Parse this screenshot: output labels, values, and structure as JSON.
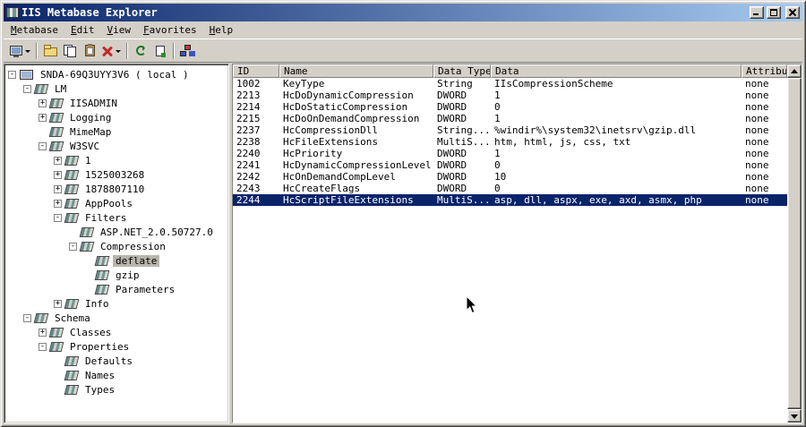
{
  "window": {
    "title": "IIS Metabase Explorer"
  },
  "colors": {
    "chrome": "#d4d0c8",
    "titlebar_start": "#0a246a",
    "titlebar_end": "#a6caf0",
    "selection": "#0a246a",
    "inactive_selection": "#b8b5ac"
  },
  "menu": {
    "items": [
      {
        "key": "M",
        "rest": "etabase"
      },
      {
        "key": "E",
        "rest": "dit"
      },
      {
        "key": "V",
        "rest": "iew"
      },
      {
        "key": "F",
        "rest": "avorites"
      },
      {
        "key": "H",
        "rest": "elp"
      }
    ]
  },
  "toolbar": {
    "buttons": [
      "connect",
      "new-key",
      "copy",
      "paste",
      "delete",
      "refresh",
      "export",
      "network"
    ]
  },
  "tree": {
    "items": [
      {
        "label": "SNDA-69Q3UYY3V6 ( local )",
        "expander": "-"
      },
      {
        "label": "LM",
        "expander": "-"
      },
      {
        "label": "IISADMIN",
        "expander": "+"
      },
      {
        "label": "Logging",
        "expander": "+"
      },
      {
        "label": "MimeMap",
        "expander": ""
      },
      {
        "label": "W3SVC",
        "expander": "-"
      },
      {
        "label": "1",
        "expander": "+"
      },
      {
        "label": "1525003268",
        "expander": "+"
      },
      {
        "label": "1878807110",
        "expander": "+"
      },
      {
        "label": "AppPools",
        "expander": "+"
      },
      {
        "label": "Filters",
        "expander": "-"
      },
      {
        "label": "ASP.NET_2.0.50727.0",
        "expander": ""
      },
      {
        "label": "Compression",
        "expander": "-"
      },
      {
        "label": "deflate",
        "expander": ""
      },
      {
        "label": "gzip",
        "expander": ""
      },
      {
        "label": "Parameters",
        "expander": ""
      },
      {
        "label": "Info",
        "expander": "+"
      },
      {
        "label": "Schema",
        "expander": "-"
      },
      {
        "label": "Classes",
        "expander": "+"
      },
      {
        "label": "Properties",
        "expander": "-"
      },
      {
        "label": "Defaults",
        "expander": ""
      },
      {
        "label": "Names",
        "expander": ""
      },
      {
        "label": "Types",
        "expander": ""
      }
    ]
  },
  "table": {
    "columns": [
      "ID",
      "Name",
      "Data Type",
      "Data",
      "Attributes"
    ],
    "rows": [
      {
        "id": "1002",
        "name": "KeyType",
        "type": "String",
        "data": "IIsCompressionScheme",
        "attributes": "none"
      },
      {
        "id": "2213",
        "name": "HcDoDynamicCompression",
        "type": "DWORD",
        "data": "1",
        "attributes": "none"
      },
      {
        "id": "2214",
        "name": "HcDoStaticCompression",
        "type": "DWORD",
        "data": "0",
        "attributes": "none"
      },
      {
        "id": "2215",
        "name": "HcDoOnDemandCompression",
        "type": "DWORD",
        "data": "1",
        "attributes": "none"
      },
      {
        "id": "2237",
        "name": "HcCompressionDll",
        "type": "String...",
        "data": "%windir%\\system32\\inetsrv\\gzip.dll",
        "attributes": "none"
      },
      {
        "id": "2238",
        "name": "HcFileExtensions",
        "type": "MultiS...",
        "data": "htm, html, js, css, txt",
        "attributes": "none"
      },
      {
        "id": "2240",
        "name": "HcPriority",
        "type": "DWORD",
        "data": "1",
        "attributes": "none"
      },
      {
        "id": "2241",
        "name": "HcDynamicCompressionLevel",
        "type": "DWORD",
        "data": "0",
        "attributes": "none"
      },
      {
        "id": "2242",
        "name": "HcOnDemandCompLevel",
        "type": "DWORD",
        "data": "10",
        "attributes": "none"
      },
      {
        "id": "2243",
        "name": "HcCreateFlags",
        "type": "DWORD",
        "data": "0",
        "attributes": "none"
      },
      {
        "id": "2244",
        "name": "HcScriptFileExtensions",
        "type": "MultiS...",
        "data": "asp, dll, aspx, exe, axd, asmx, php",
        "attributes": "none"
      }
    ]
  }
}
